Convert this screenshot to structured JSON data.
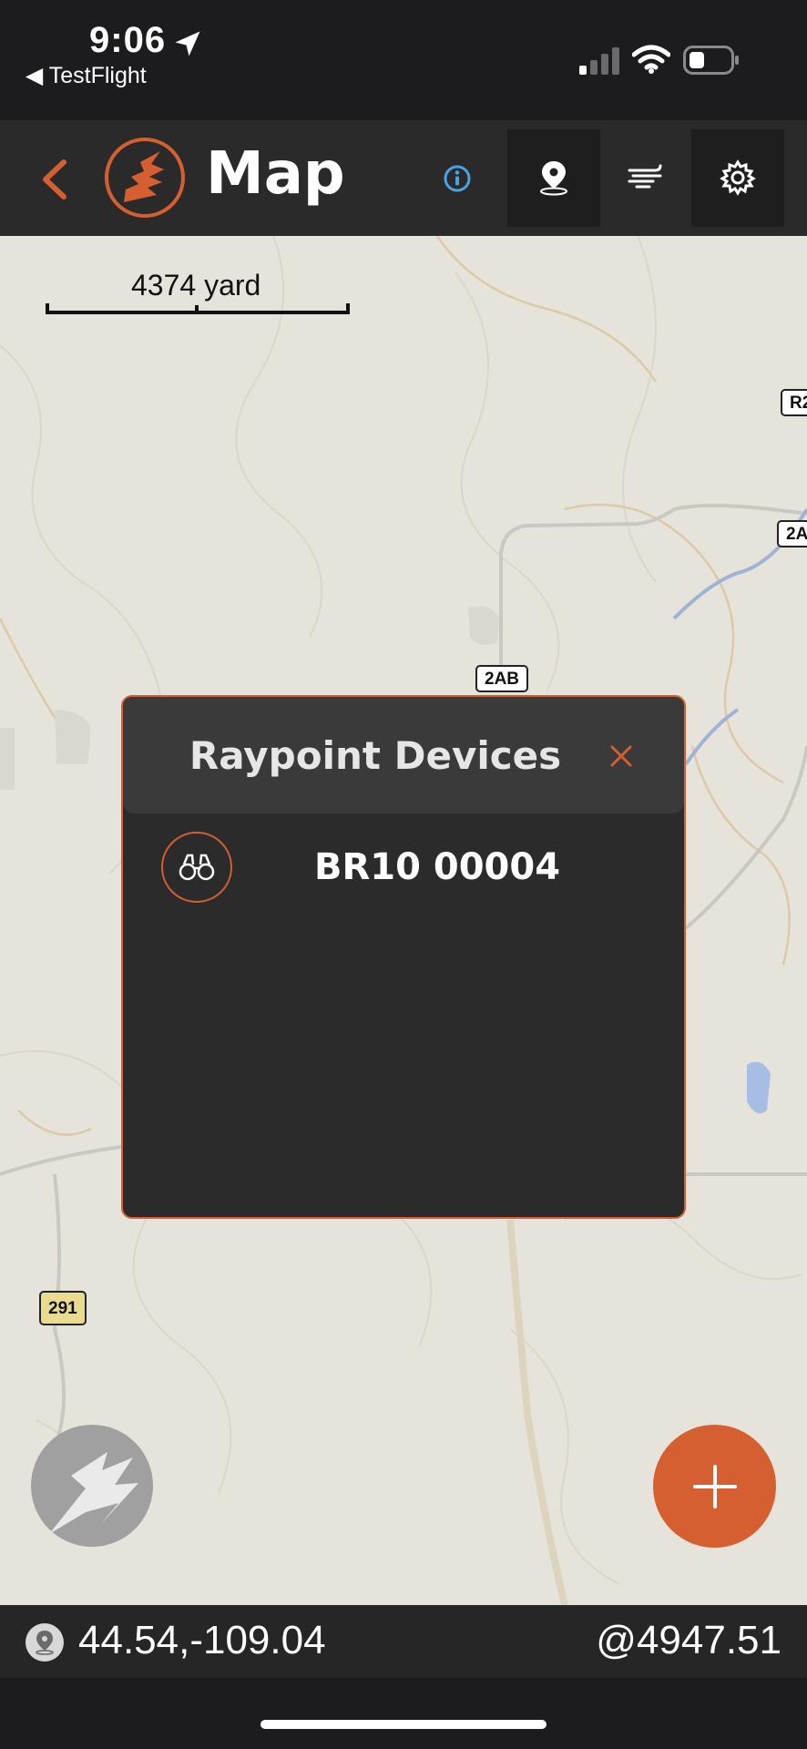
{
  "status_bar": {
    "time": "9:06",
    "back_app": "◀ TestFlight"
  },
  "header": {
    "title": "Map"
  },
  "map": {
    "scale_label": "4374 yard",
    "road_labels": [
      "2AB",
      "291",
      "R2",
      "2A"
    ]
  },
  "modal": {
    "title": "Raypoint Devices",
    "devices": [
      {
        "name": "BR10 00004",
        "icon": "binoculars-icon"
      }
    ]
  },
  "footer": {
    "coordinates": "44.54,-109.04",
    "elevation": "@4947.51"
  },
  "colors": {
    "accent": "#d65f31",
    "header_bg": "#2a2a2a",
    "map_bg": "#e6e4da",
    "info_blue": "#4aa3e0"
  }
}
